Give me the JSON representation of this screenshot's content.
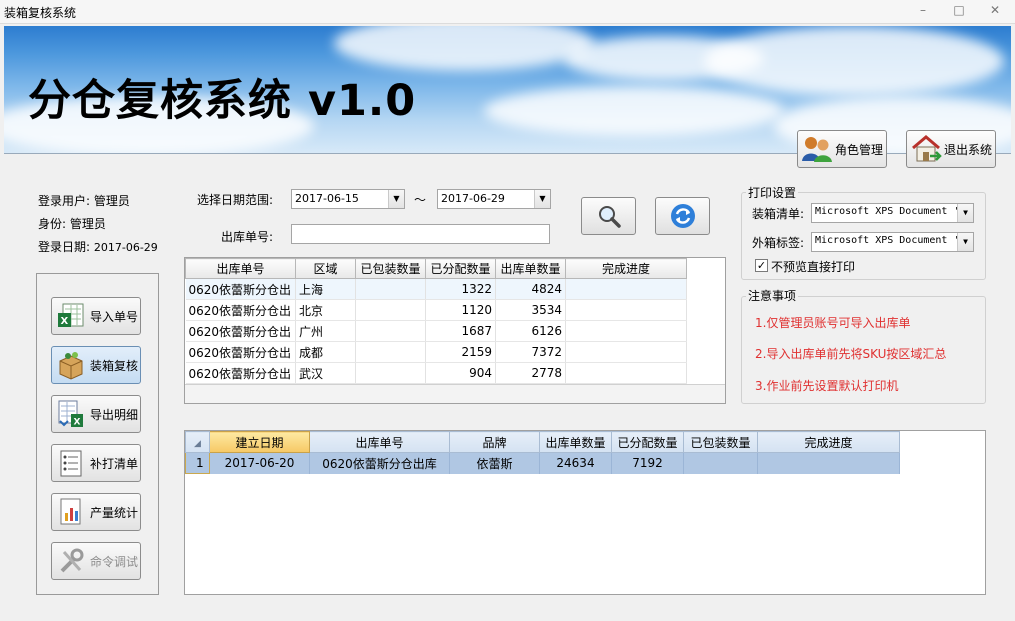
{
  "window": {
    "title": "装箱复核系统",
    "min_glyph": "–",
    "max_glyph": "□",
    "close_glyph": "✕"
  },
  "banner": {
    "title": "分仓复核系统 v1.0"
  },
  "header_buttons": {
    "role_label": "角色管理",
    "exit_label": "退出系统"
  },
  "user": {
    "login_user_label": "登录用户:",
    "login_user": "管理员",
    "identity_label": "身份:",
    "identity": "管理员",
    "login_date_label": "登录日期:",
    "login_date": "2017-06-29"
  },
  "nav": {
    "import": "导入单号",
    "packing_review": "装箱复核",
    "export_detail": "导出明细",
    "reprint_list": "补打清单",
    "production_stats": "产量统计",
    "command_debug": "命令调试"
  },
  "filters": {
    "date_range_label": "选择日期范围:",
    "date_from": "2017-06-15",
    "range_sep": "～",
    "date_to": "2017-06-29",
    "order_no_label": "出库单号:",
    "order_no_value": ""
  },
  "grid1": {
    "columns": [
      "出库单号",
      "区域",
      "已包装数量",
      "已分配数量",
      "出库单数量",
      "完成进度"
    ],
    "rows": [
      [
        "0620依蕾斯分仓出",
        "上海",
        "",
        "1322",
        "4824",
        ""
      ],
      [
        "0620依蕾斯分仓出",
        "北京",
        "",
        "1120",
        "3534",
        ""
      ],
      [
        "0620依蕾斯分仓出",
        "广州",
        "",
        "1687",
        "6126",
        ""
      ],
      [
        "0620依蕾斯分仓出",
        "成都",
        "",
        "2159",
        "7372",
        ""
      ],
      [
        "0620依蕾斯分仓出",
        "武汉",
        "",
        "904",
        "2778",
        ""
      ]
    ]
  },
  "grid2": {
    "columns": [
      "建立日期",
      "出库单号",
      "品牌",
      "出库单数量",
      "已分配数量",
      "已包装数量",
      "完成进度"
    ],
    "rows": [
      {
        "index": "1",
        "cells": [
          "2017-06-20",
          "0620依蕾斯分仓出库",
          "依蕾斯",
          "24634",
          "7192",
          "",
          ""
        ]
      }
    ]
  },
  "print_settings": {
    "title": "打印设置",
    "packing_list_label": "装箱清单:",
    "packing_list_printer": "Microsoft XPS Document '",
    "box_label_label": "外箱标签:",
    "box_label_printer": "Microsoft XPS Document '",
    "no_preview_label": "不预览直接打印",
    "no_preview_checked": true
  },
  "notes": {
    "title": "注意事项",
    "items": [
      "1.仅管理员账号可导入出库单",
      "2.导入出库单前先将SKU按区域汇总",
      "3.作业前先设置默认打印机"
    ],
    "color": "#e03030"
  }
}
